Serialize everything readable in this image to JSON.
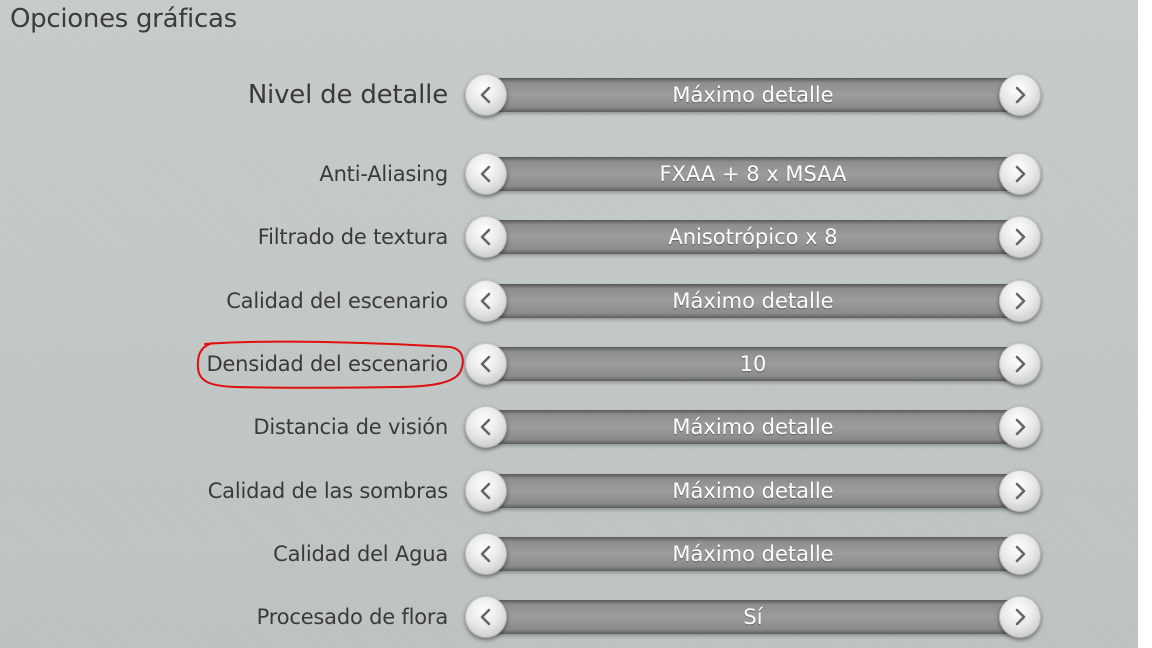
{
  "panel": {
    "title": "Opciones gráficas"
  },
  "settings": [
    {
      "label": "Nivel de detalle",
      "value": "Máximo detalle"
    },
    {
      "label": "Anti-Aliasing",
      "value": "FXAA + 8 x MSAA"
    },
    {
      "label": "Filtrado de textura",
      "value": "Anisotrópico x 8"
    },
    {
      "label": "Calidad del escenario",
      "value": "Máximo detalle"
    },
    {
      "label": "Densidad del escenario",
      "value": "10"
    },
    {
      "label": "Distancia de visión",
      "value": "Máximo detalle"
    },
    {
      "label": "Calidad de las sombras",
      "value": "Máximo detalle"
    },
    {
      "label": "Calidad del Agua",
      "value": "Máximo detalle"
    },
    {
      "label": "Procesado de flora",
      "value": "Sí"
    }
  ],
  "icons": {
    "prev": "chevron-left-icon",
    "next": "chevron-right-icon"
  },
  "colors": {
    "background": "#c3c9c9",
    "bar": "#9c9c9c",
    "value_text": "#ffffff",
    "label_text": "#3a3a3a",
    "annotation": "#e01010"
  }
}
